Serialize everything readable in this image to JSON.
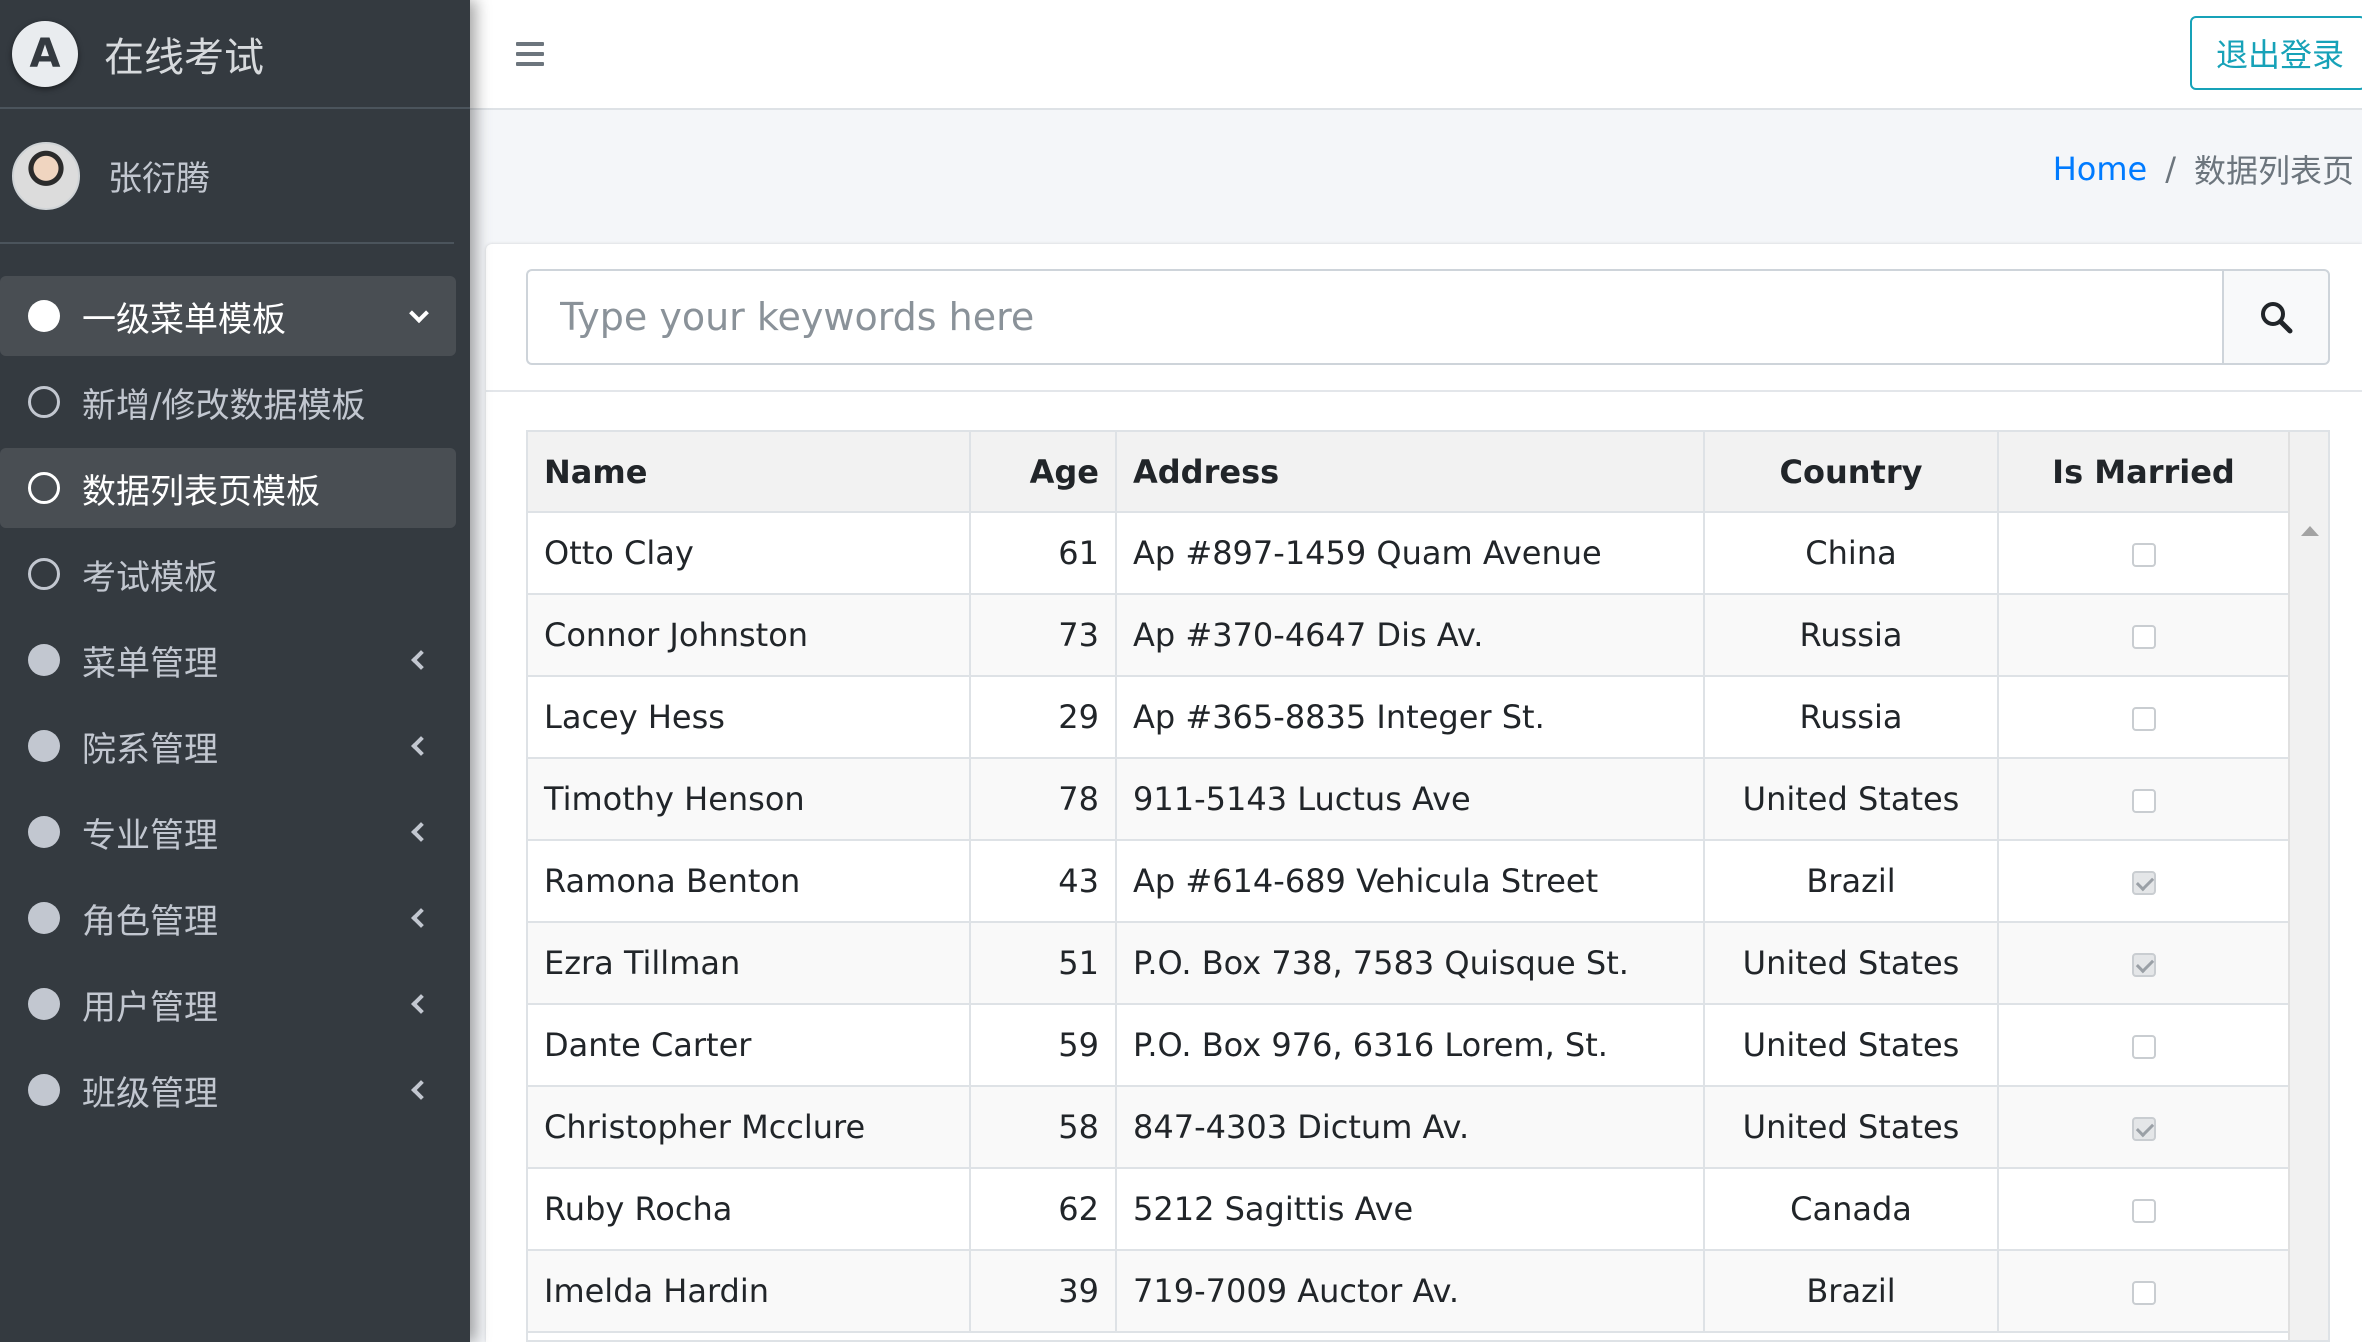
{
  "app": {
    "brand_logo_letter": "A",
    "brand_title": "在线考试"
  },
  "user": {
    "name": "张衍腾"
  },
  "sidebar": {
    "items": [
      {
        "label": "一级菜单模板",
        "icon": "circle-solid",
        "state": "open",
        "chevron": "down"
      },
      {
        "label": "新增/修改数据模板",
        "icon": "circle-outline",
        "state": "normal"
      },
      {
        "label": "数据列表页模板",
        "icon": "circle-outline",
        "state": "active"
      },
      {
        "label": "考试模板",
        "icon": "circle-outline",
        "state": "normal"
      },
      {
        "label": "菜单管理",
        "icon": "circle-solid",
        "state": "collapsed",
        "chevron": "left"
      },
      {
        "label": "院系管理",
        "icon": "circle-solid",
        "state": "collapsed",
        "chevron": "left"
      },
      {
        "label": "专业管理",
        "icon": "circle-solid",
        "state": "collapsed",
        "chevron": "left"
      },
      {
        "label": "角色管理",
        "icon": "circle-solid",
        "state": "collapsed",
        "chevron": "left"
      },
      {
        "label": "用户管理",
        "icon": "circle-solid",
        "state": "collapsed",
        "chevron": "left"
      },
      {
        "label": "班级管理",
        "icon": "circle-solid",
        "state": "collapsed",
        "chevron": "left"
      }
    ]
  },
  "header": {
    "menu_icon": "hamburger-icon",
    "logout_label": "退出登录"
  },
  "breadcrumb": {
    "home": "Home",
    "separator": "/",
    "current": "数据列表页"
  },
  "search": {
    "placeholder": "Type your keywords here",
    "value": "",
    "button_icon": "search-icon"
  },
  "table": {
    "columns": [
      "Name",
      "Age",
      "Address",
      "Country",
      "Is Married"
    ],
    "rows": [
      {
        "name": "Otto Clay",
        "age": "61",
        "address": "Ap #897-1459 Quam Avenue",
        "country": "China",
        "married": false
      },
      {
        "name": "Connor Johnston",
        "age": "73",
        "address": "Ap #370-4647 Dis Av.",
        "country": "Russia",
        "married": false
      },
      {
        "name": "Lacey Hess",
        "age": "29",
        "address": "Ap #365-8835 Integer St.",
        "country": "Russia",
        "married": false
      },
      {
        "name": "Timothy Henson",
        "age": "78",
        "address": "911-5143 Luctus Ave",
        "country": "United States",
        "married": false
      },
      {
        "name": "Ramona Benton",
        "age": "43",
        "address": "Ap #614-689 Vehicula Street",
        "country": "Brazil",
        "married": true
      },
      {
        "name": "Ezra Tillman",
        "age": "51",
        "address": "P.O. Box 738, 7583 Quisque St.",
        "country": "United States",
        "married": true
      },
      {
        "name": "Dante Carter",
        "age": "59",
        "address": "P.O. Box 976, 6316 Lorem, St.",
        "country": "United States",
        "married": false
      },
      {
        "name": "Christopher Mcclure",
        "age": "58",
        "address": "847-4303 Dictum Av.",
        "country": "United States",
        "married": true
      },
      {
        "name": "Ruby Rocha",
        "age": "62",
        "address": "5212 Sagittis Ave",
        "country": "Canada",
        "married": false
      },
      {
        "name": "Imelda Hardin",
        "age": "39",
        "address": "719-7009 Auctor Av.",
        "country": "Brazil",
        "married": false
      }
    ]
  },
  "colors": {
    "sidebar_bg": "#343a40",
    "accent_link": "#007bff",
    "logout_accent": "#17a2b8"
  }
}
